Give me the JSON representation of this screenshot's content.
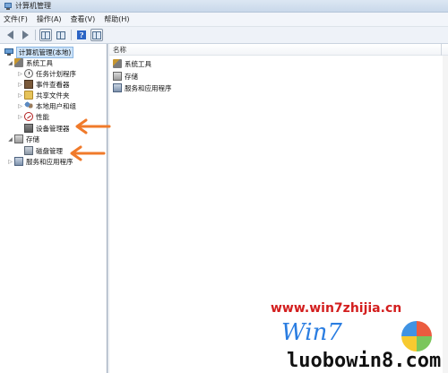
{
  "window": {
    "title": "计算机管理"
  },
  "menu": [
    "文件(F)",
    "操作(A)",
    "查看(V)",
    "帮助(H)"
  ],
  "toolbar": {
    "buttons": [
      "back-icon",
      "forward-icon",
      "show-tree-icon",
      "properties-icon",
      "help-icon",
      "show-pane-icon"
    ]
  },
  "tree": {
    "root": "计算机管理(本地)",
    "system_tools": "系统工具",
    "task_scheduler": "任务计划程序",
    "event_viewer": "事件查看器",
    "shared_folders": "共享文件夹",
    "local_users": "本地用户和组",
    "performance": "性能",
    "device_manager": "设备管理器",
    "storage": "存储",
    "disk_management": "磁盘管理",
    "services_apps": "服务和应用程序"
  },
  "list": {
    "column_name": "名称",
    "items": [
      "系统工具",
      "存储",
      "服务和应用程序"
    ]
  },
  "watermark": {
    "url": "www.win7zhijia.cn",
    "brand": "Win7",
    "url2": "luobowin8.com"
  },
  "colors": {
    "annotation_arrow": "#f07a2a",
    "selection": "#cde3f8",
    "watermark_red": "#d31e1e",
    "watermark_blue": "#2a7de1"
  }
}
